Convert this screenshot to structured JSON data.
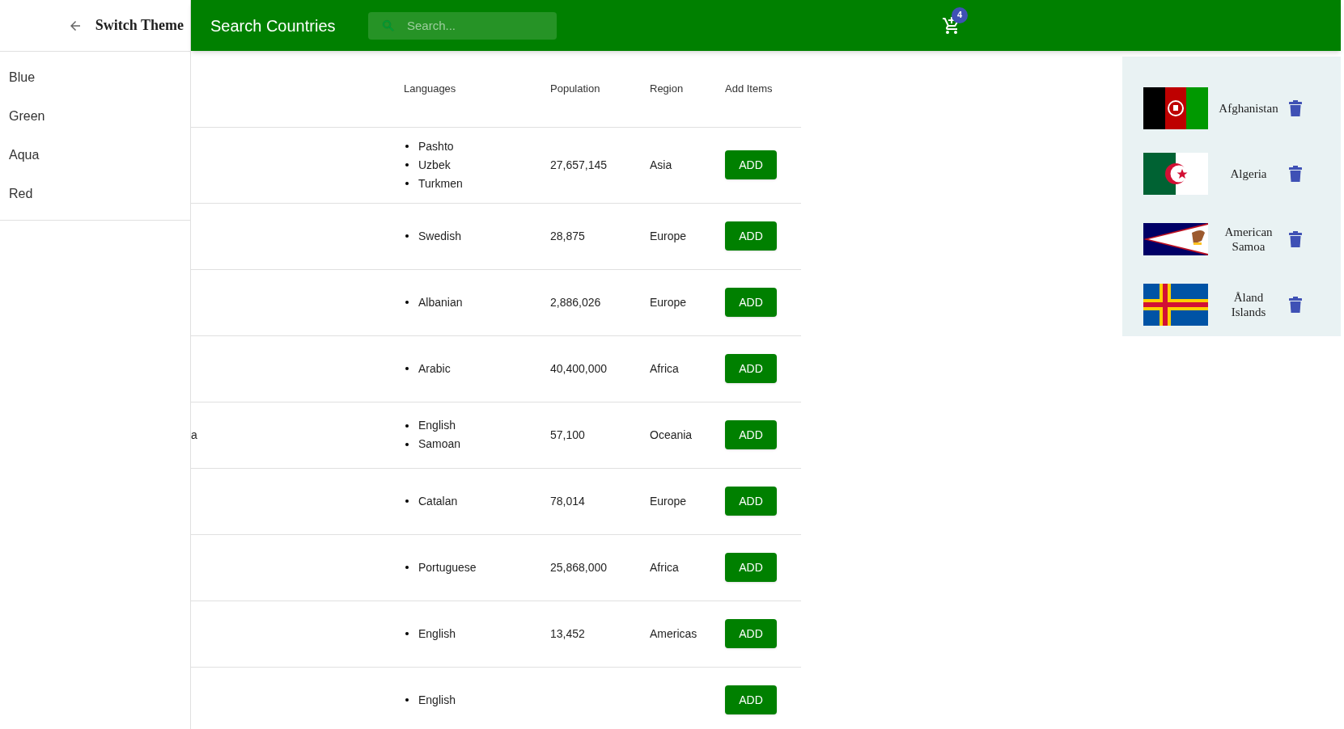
{
  "drawer": {
    "title": "Switch Theme",
    "items": [
      "Blue",
      "Green",
      "Aqua",
      "Red"
    ]
  },
  "app_bar": {
    "title": "Search Countries",
    "search": {
      "placeholder": "Search..."
    },
    "cart_count": "4"
  },
  "table": {
    "columns": [
      "Languages",
      "Population",
      "Region",
      "Add Items"
    ],
    "rows": [
      {
        "languages": [
          "Pashto",
          "Uzbek",
          "Turkmen"
        ],
        "population": "27,657,145",
        "region": "Asia",
        "button": "ADD"
      },
      {
        "languages": [
          "Swedish"
        ],
        "population": "28,875",
        "region": "Europe",
        "button": "ADD"
      },
      {
        "languages": [
          "Albanian"
        ],
        "population": "2,886,026",
        "region": "Europe",
        "button": "ADD"
      },
      {
        "languages": [
          "Arabic"
        ],
        "population": "40,400,000",
        "region": "Africa",
        "button": "ADD"
      },
      {
        "column_1": "a",
        "languages": [
          "English",
          "Samoan"
        ],
        "population": "57,100",
        "region": "Oceania",
        "button": "ADD"
      },
      {
        "languages": [
          "Catalan"
        ],
        "population": "78,014",
        "region": "Europe",
        "button": "ADD"
      },
      {
        "languages": [
          "Portuguese"
        ],
        "population": "25,868,000",
        "region": "Africa",
        "button": "ADD"
      },
      {
        "languages": [
          "English"
        ],
        "population": "13,452",
        "region": "Americas",
        "button": "ADD"
      },
      {
        "languages": [
          "English"
        ],
        "button": "ADD"
      }
    ]
  },
  "cart": [
    {
      "kind": "afghanistan",
      "name": "Afghanistan"
    },
    {
      "kind": "algeria",
      "name": "Algeria"
    },
    {
      "kind": "samoa",
      "name": "American Samoa"
    },
    {
      "kind": "aland",
      "name": "Åland Islands"
    }
  ]
}
